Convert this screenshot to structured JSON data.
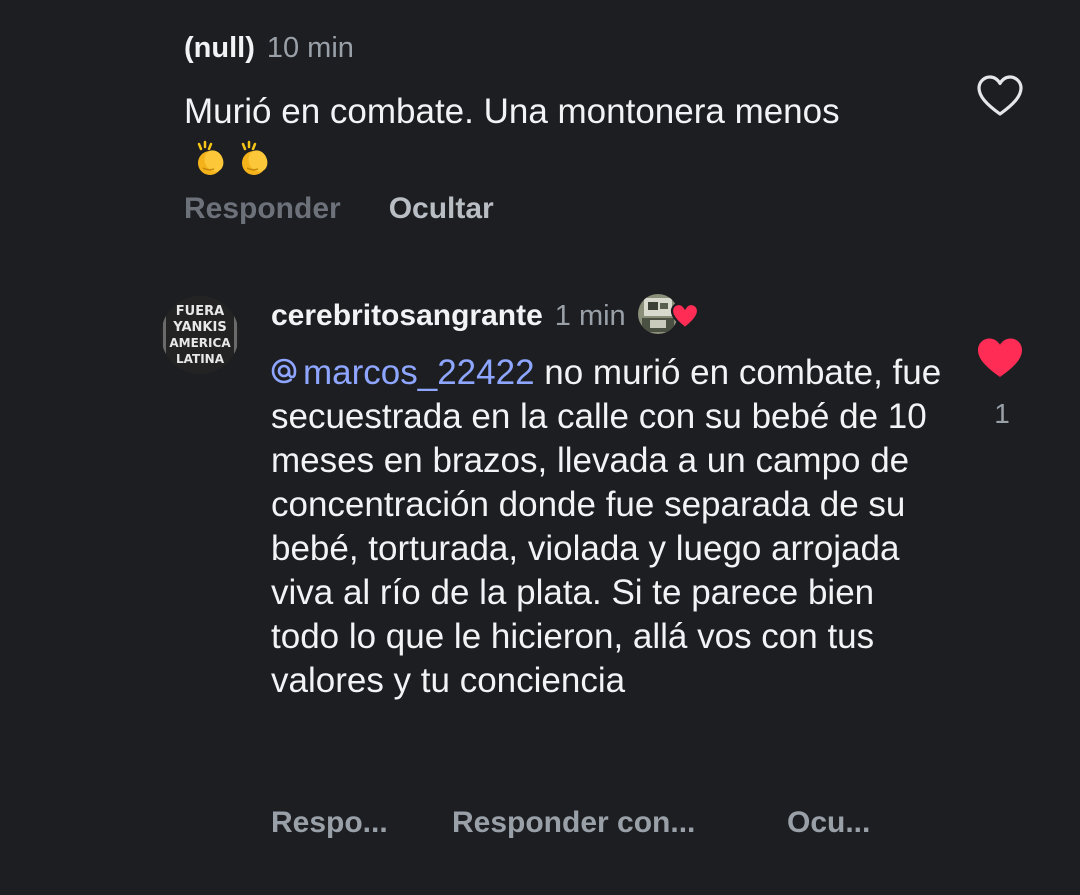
{
  "comments": [
    {
      "username": "(null)",
      "time": "10 min",
      "text": "Murió en combate. Una montonera menos",
      "emoji": [
        "👏",
        "👏"
      ],
      "actions": {
        "reply": "Responder",
        "hide": "Ocultar"
      },
      "liked": false,
      "icon": "heart-outline-icon"
    },
    {
      "username": "cerebritosangrante",
      "time": "1 min",
      "mention": "marcos_22422",
      "text": " no murió en combate, fue secuestrada en la calle con su bebé de 10 meses en brazos, llevada a un campo de concentración donde fue separada de su bebé, torturada, violada y luego arrojada viva al río de la plata. Si te parece bien todo lo que le hicieron, allá vos con tus valores y tu conciencia",
      "actions": {
        "reply": "Respo...",
        "reply_with": "Responder con...",
        "hide": "Ocu..."
      },
      "liked": true,
      "like_count": "1",
      "icon": "heart-filled-icon"
    }
  ],
  "colors": {
    "background": "#1c1e22",
    "text": "#f2f3f5",
    "muted": "#9aa0a8",
    "mention": "#8ea6ff",
    "like": "#ff2d55"
  },
  "avatar_text": [
    "FUERA",
    "YANKIS",
    "AMERICA",
    "LATINA"
  ]
}
